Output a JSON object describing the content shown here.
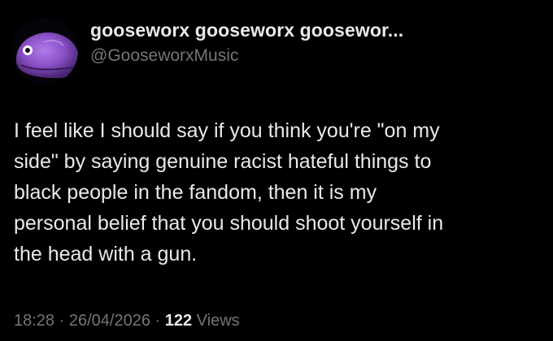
{
  "tweet": {
    "display_name": "gooseworx gooseworx goosewor...",
    "handle": "@GooseworxMusic",
    "avatar_icon": "purple-fish-avatar-icon",
    "body_lines": [
      "I feel like I should say if you think you're \"on my",
      "side\" by saying genuine racist hateful things to",
      "black people in the fandom, then it is my",
      "personal belief that you should shoot yourself in",
      "the head with a gun."
    ],
    "time": "18:28",
    "separator": " · ",
    "date": "26/04/2026",
    "views_count": "122",
    "views_label": " Views"
  },
  "colors": {
    "background": "#000000",
    "primary_text": "#e7e9ea",
    "secondary_text": "#71767b",
    "avatar_purple": "#8a52c8"
  }
}
